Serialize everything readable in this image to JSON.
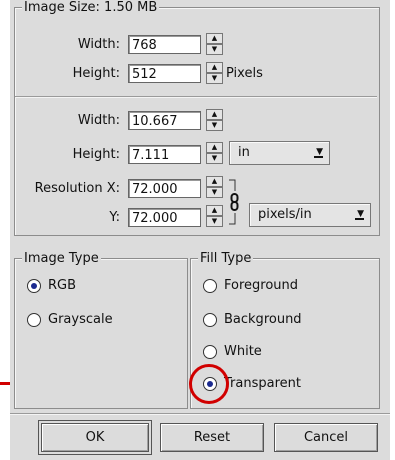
{
  "image_size": {
    "legend": "Image Size: 1.50 MB",
    "pixel_width_label": "Width:",
    "pixel_width_value": "768",
    "pixel_height_label": "Height:",
    "pixel_height_value": "512",
    "pixel_unit": "Pixels",
    "print_width_label": "Width:",
    "print_width_value": "10.667",
    "print_height_label": "Height:",
    "print_height_value": "7.111",
    "print_unit": "in",
    "resolution_x_label": "Resolution X:",
    "resolution_x_value": "72.000",
    "resolution_y_label": "Y:",
    "resolution_y_value": "72.000",
    "resolution_unit": "pixels/in"
  },
  "image_type": {
    "legend": "Image Type",
    "options": [
      {
        "label": "RGB",
        "selected": true
      },
      {
        "label": "Grayscale",
        "selected": false
      }
    ]
  },
  "fill_type": {
    "legend": "Fill Type",
    "options": [
      {
        "label": "Foreground",
        "selected": false
      },
      {
        "label": "Background",
        "selected": false
      },
      {
        "label": "White",
        "selected": false
      },
      {
        "label": "Transparent",
        "selected": true
      }
    ]
  },
  "buttons": {
    "ok": "OK",
    "reset": "Reset",
    "cancel": "Cancel"
  },
  "annotation": {
    "color": "#d10000",
    "icon": "red-highlight-circle-with-pointer-line"
  }
}
